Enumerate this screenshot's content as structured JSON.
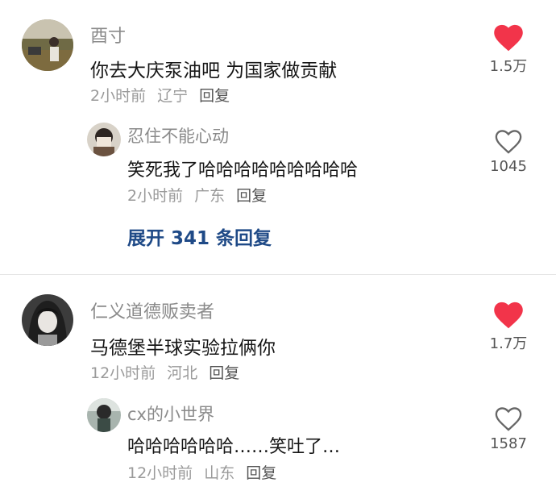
{
  "comments": [
    {
      "user": "酉寸",
      "text": "你去大庆泵油吧 为国家做贡献",
      "time": "2小时前",
      "location": "辽宁",
      "reply_label": "回复",
      "likes": "1.5万",
      "liked": true,
      "replies": [
        {
          "user": "忍住不能心动",
          "text": "笑死我了哈哈哈哈哈哈哈哈哈",
          "time": "2小时前",
          "location": "广东",
          "reply_label": "回复",
          "likes": "1045",
          "liked": false
        }
      ],
      "expand_label": "展开 341 条回复"
    },
    {
      "user": "仁义道德贩卖者",
      "text": "马德堡半球实验拉俩你",
      "time": "12小时前",
      "location": "河北",
      "reply_label": "回复",
      "likes": "1.7万",
      "liked": true,
      "replies": [
        {
          "user": "cx的小世界",
          "text": "哈哈哈哈哈哈……笑吐了…",
          "time": "12小时前",
          "location": "山东",
          "reply_label": "回复",
          "likes": "1587",
          "liked": false
        }
      ]
    }
  ],
  "colors": {
    "heart_liked": "#f2344a",
    "heart_outline": "#666666",
    "expand_link": "#1f4a87"
  },
  "icons": {
    "liked": "heart-filled-icon",
    "not_liked": "heart-outline-icon"
  }
}
